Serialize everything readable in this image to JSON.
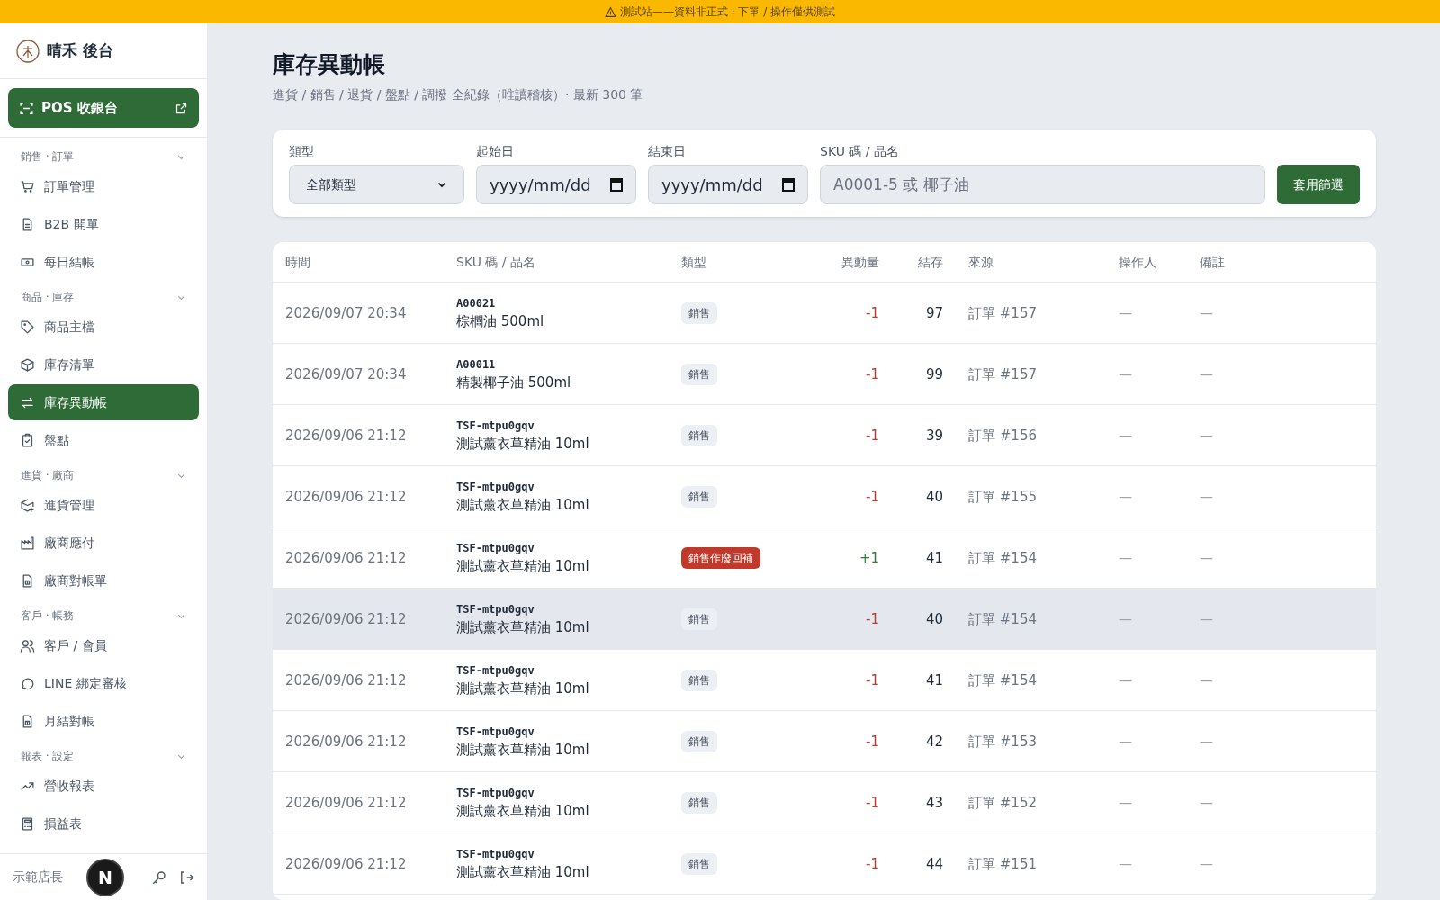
{
  "banner": {
    "text": "測試站——資料非正式 · 下單 / 操作僅供測試"
  },
  "sidebar": {
    "brand": "晴禾 後台",
    "pos_button": "POS 收銀台",
    "sections": [
      {
        "title": "銷售 · 訂單",
        "expanded": true,
        "items": [
          {
            "label": "訂單管理",
            "selected": false
          },
          {
            "label": "B2B 開單",
            "selected": false
          },
          {
            "label": "每日結帳",
            "selected": false
          }
        ]
      },
      {
        "title": "商品 · 庫存",
        "expanded": true,
        "items": [
          {
            "label": "商品主檔",
            "selected": false
          },
          {
            "label": "庫存清單",
            "selected": false
          },
          {
            "label": "庫存異動帳",
            "selected": true
          },
          {
            "label": "盤點",
            "selected": false
          }
        ]
      },
      {
        "title": "進貨 · 廠商",
        "expanded": true,
        "items": [
          {
            "label": "進貨管理",
            "selected": false
          },
          {
            "label": "廠商應付",
            "selected": false
          },
          {
            "label": "廠商對帳單",
            "selected": false
          }
        ]
      },
      {
        "title": "客戶 · 帳務",
        "expanded": true,
        "items": [
          {
            "label": "客戶 / 會員",
            "selected": false
          },
          {
            "label": "LINE 綁定審核",
            "selected": false
          },
          {
            "label": "月結對帳",
            "selected": false
          }
        ]
      },
      {
        "title": "報表 · 設定",
        "expanded": true,
        "items": [
          {
            "label": "營收報表",
            "selected": false
          },
          {
            "label": "損益表",
            "selected": false
          }
        ]
      }
    ],
    "user": "示範店長",
    "dev_badge": "N"
  },
  "page": {
    "title": "庫存異動帳",
    "subtitle": "進貨 / 銷售 / 退貨 / 盤點 / 調撥 全紀錄（唯讀稽核）· 最新 300 筆"
  },
  "filters": {
    "type_label": "類型",
    "type_value": "全部類型",
    "start_label": "起始日",
    "start_value": "yyyy/mm/dd",
    "end_label": "結束日",
    "end_value": "yyyy/mm/dd",
    "sku_label": "SKU 碼 / 品名",
    "sku_placeholder": "A0001-5 或 椰子油",
    "apply": "套用篩選"
  },
  "table": {
    "columns": [
      "時間",
      "SKU 碼 / 品名",
      "類型",
      "異動量",
      "結存",
      "來源",
      "操作人",
      "備註"
    ],
    "rows": [
      {
        "time": "2026/09/07 20:34",
        "sku": "A00021",
        "name": "棕櫚油 500ml",
        "type": "銷售",
        "kind": "sale",
        "qty": "-1",
        "stock": "97",
        "source": "訂單 #157",
        "operator": "—",
        "note": "—",
        "hovered": false
      },
      {
        "time": "2026/09/07 20:34",
        "sku": "A00011",
        "name": "精製椰子油 500ml",
        "type": "銷售",
        "kind": "sale",
        "qty": "-1",
        "stock": "99",
        "source": "訂單 #157",
        "operator": "—",
        "note": "—",
        "hovered": false
      },
      {
        "time": "2026/09/06 21:12",
        "sku": "TSF-mtpu0gqv",
        "name": "測試薰衣草精油 10ml",
        "type": "銷售",
        "kind": "sale",
        "qty": "-1",
        "stock": "39",
        "source": "訂單 #156",
        "operator": "—",
        "note": "—",
        "hovered": false
      },
      {
        "time": "2026/09/06 21:12",
        "sku": "TSF-mtpu0gqv",
        "name": "測試薰衣草精油 10ml",
        "type": "銷售",
        "kind": "sale",
        "qty": "-1",
        "stock": "40",
        "source": "訂單 #155",
        "operator": "—",
        "note": "—",
        "hovered": false
      },
      {
        "time": "2026/09/06 21:12",
        "sku": "TSF-mtpu0gqv",
        "name": "測試薰衣草精油 10ml",
        "type": "銷售作廢回補",
        "kind": "void",
        "qty": "+1",
        "stock": "41",
        "source": "訂單 #154",
        "operator": "—",
        "note": "—",
        "hovered": false
      },
      {
        "time": "2026/09/06 21:12",
        "sku": "TSF-mtpu0gqv",
        "name": "測試薰衣草精油 10ml",
        "type": "銷售",
        "kind": "sale",
        "qty": "-1",
        "stock": "40",
        "source": "訂單 #154",
        "operator": "—",
        "note": "—",
        "hovered": true
      },
      {
        "time": "2026/09/06 21:12",
        "sku": "TSF-mtpu0gqv",
        "name": "測試薰衣草精油 10ml",
        "type": "銷售",
        "kind": "sale",
        "qty": "-1",
        "stock": "41",
        "source": "訂單 #154",
        "operator": "—",
        "note": "—",
        "hovered": false
      },
      {
        "time": "2026/09/06 21:12",
        "sku": "TSF-mtpu0gqv",
        "name": "測試薰衣草精油 10ml",
        "type": "銷售",
        "kind": "sale",
        "qty": "-1",
        "stock": "42",
        "source": "訂單 #153",
        "operator": "—",
        "note": "—",
        "hovered": false
      },
      {
        "time": "2026/09/06 21:12",
        "sku": "TSF-mtpu0gqv",
        "name": "測試薰衣草精油 10ml",
        "type": "銷售",
        "kind": "sale",
        "qty": "-1",
        "stock": "43",
        "source": "訂單 #152",
        "operator": "—",
        "note": "—",
        "hovered": false
      },
      {
        "time": "2026/09/06 21:12",
        "sku": "TSF-mtpu0gqv",
        "name": "測試薰衣草精油 10ml",
        "type": "銷售",
        "kind": "sale",
        "qty": "-1",
        "stock": "44",
        "source": "訂單 #151",
        "operator": "—",
        "note": "—",
        "hovered": false
      }
    ]
  }
}
